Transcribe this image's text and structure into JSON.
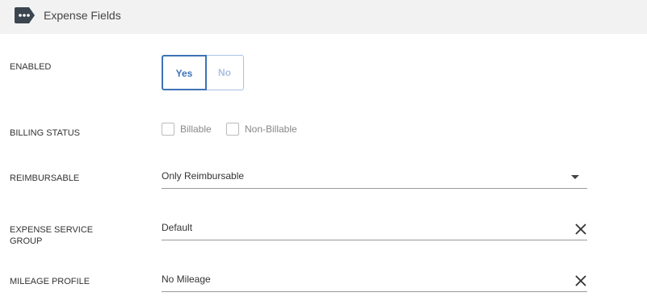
{
  "header": {
    "title": "Expense Fields",
    "icon": "tag-more-icon"
  },
  "enabled": {
    "label": "ENABLED",
    "yes_label": "Yes",
    "no_label": "No",
    "selected": "Yes"
  },
  "billing_status": {
    "label": "BILLING STATUS",
    "options": [
      {
        "label": "Billable",
        "checked": false
      },
      {
        "label": "Non-Billable",
        "checked": false
      }
    ]
  },
  "reimbursable": {
    "label": "REIMBURSABLE",
    "value": "Only Reimbursable"
  },
  "expense_service_group": {
    "label_line1": "EXPENSE SERVICE",
    "label_line2": "GROUP",
    "value": "Default"
  },
  "mileage_profile": {
    "label": "MILEAGE PROFILE",
    "value": "No Mileage"
  },
  "colors": {
    "accent": "#3d73b7",
    "header_bg": "#f2f2f2"
  }
}
